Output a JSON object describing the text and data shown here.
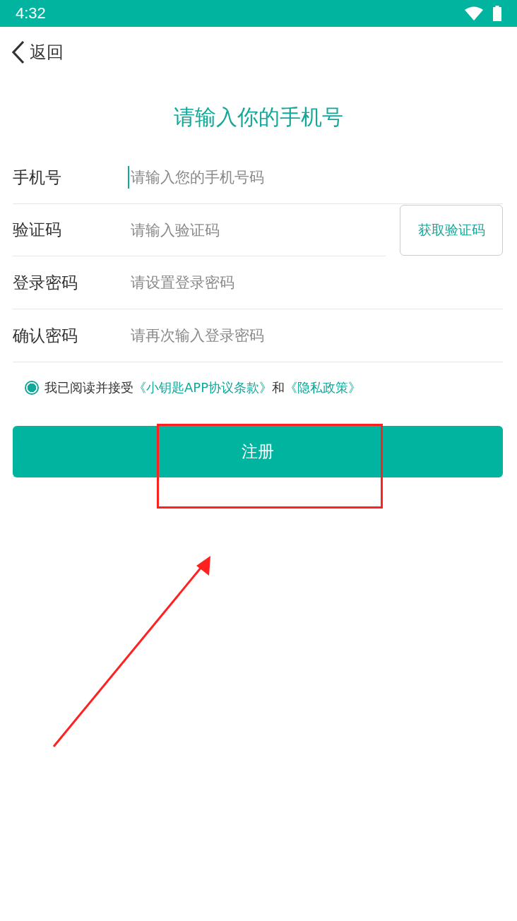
{
  "status_bar": {
    "time": "4:32"
  },
  "nav": {
    "back_label": "返回"
  },
  "title": "请输入你的手机号",
  "fields": [
    {
      "kind": "text",
      "label": "手机号",
      "placeholder": "请输入您的手机号码",
      "focused": true
    },
    {
      "kind": "code",
      "label": "验证码",
      "placeholder": "请输入验证码",
      "focused": false,
      "button": "获取验证码"
    },
    {
      "kind": "text",
      "label": "登录密码",
      "placeholder": "请设置登录密码",
      "focused": false
    },
    {
      "kind": "text",
      "label": "确认密码",
      "placeholder": "请再次输入登录密码",
      "focused": false
    }
  ],
  "agreement": {
    "checked": true,
    "parts": [
      {
        "kind": "text",
        "text": "我已阅读并接受"
      },
      {
        "kind": "link",
        "text": "《小钥匙APP协议条款》"
      },
      {
        "kind": "text",
        "text": "和"
      },
      {
        "kind": "link",
        "text": "《隐私政策》"
      }
    ]
  },
  "submit": "注册"
}
